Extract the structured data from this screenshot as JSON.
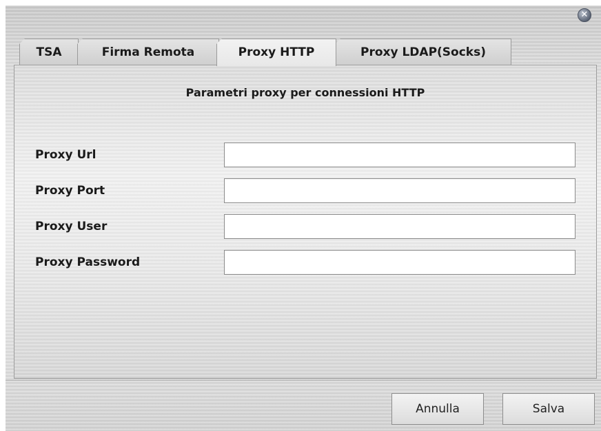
{
  "window": {
    "close_glyph": "✕",
    "close_icon": "close-circle-icon"
  },
  "tabs": [
    {
      "label": "TSA"
    },
    {
      "label": "Firma Remota"
    },
    {
      "label": "Proxy HTTP",
      "active": true
    },
    {
      "label": "Proxy LDAP(Socks)"
    }
  ],
  "panel": {
    "title": "Parametri proxy per connessioni HTTP"
  },
  "fields": [
    {
      "label": "Proxy Url",
      "value": "",
      "placeholder": ""
    },
    {
      "label": "Proxy Port",
      "value": "",
      "placeholder": ""
    },
    {
      "label": "Proxy User",
      "value": "",
      "placeholder": ""
    },
    {
      "label": "Proxy Password",
      "value": "",
      "placeholder": ""
    }
  ],
  "buttons": {
    "cancel_label": "Annulla",
    "save_label": "Salva"
  }
}
